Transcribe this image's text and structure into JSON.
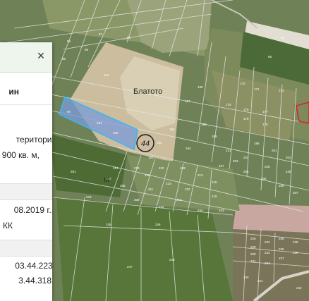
{
  "map": {
    "place_label": "Блатото",
    "zone_badge": "44",
    "roman_label": "III",
    "parcel_numbers": [
      "344",
      "262",
      "261",
      "94",
      "281",
      "192",
      "194",
      "193",
      "191",
      "175",
      "176",
      "177",
      "178",
      "179",
      "273",
      "223",
      "222",
      "210",
      "215",
      "216",
      "96",
      "98",
      "99",
      "95",
      "97",
      "55",
      "65",
      "170",
      "171",
      "174",
      "180",
      "187",
      "189",
      "190",
      "195",
      "196",
      "201",
      "202",
      "203",
      "204",
      "205",
      "206",
      "207",
      "208",
      "209",
      "211",
      "212",
      "213",
      "214",
      "217",
      "218",
      "219",
      "220",
      "221",
      "224",
      "225",
      "226",
      "227",
      "228",
      "229",
      "230",
      "231",
      "232",
      "233",
      "234",
      "235",
      "236",
      "237",
      "238",
      "239",
      "240",
      "241",
      "242",
      "243",
      "244",
      "245",
      "246",
      "247",
      "248"
    ],
    "colors": {
      "selected_fill": "#7a9bd8",
      "selected_stroke": "#3fb6f0",
      "red_parcel": "#d8262b",
      "field_light": "#cbbd9e",
      "field_green": "#5f7a3e",
      "field_dark": "#3e5a2f",
      "pink_field": "#c8a7a0"
    }
  },
  "panel": {
    "close_label": "×",
    "title_fragment": "ин",
    "area_line1": "територия",
    "area_line2": "900 кв. м,",
    "date_line1": "08.2019 г.,",
    "date_line2": "КК",
    "ids_line1": "03.44.223,",
    "ids_line2": "3.44.318"
  }
}
